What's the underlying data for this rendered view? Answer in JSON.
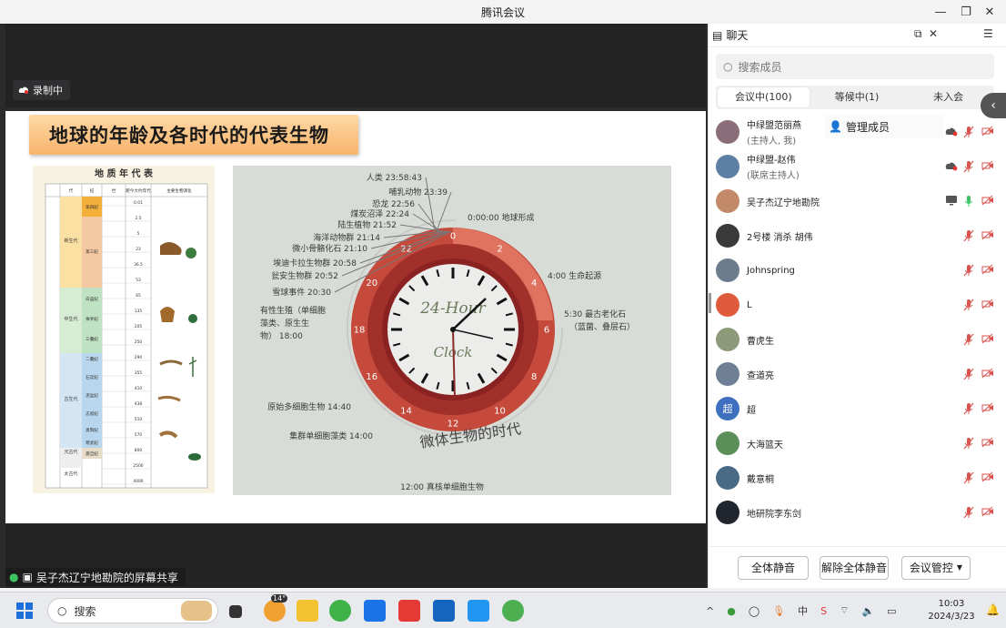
{
  "window": {
    "title": "腾讯会议"
  },
  "recording": {
    "label": "录制中"
  },
  "screen_share": {
    "label": "吴子杰辽宁地勘院的屏幕共享"
  },
  "slide": {
    "title": "地球的年龄及各时代的代表生物",
    "table_title": "地 质 年 代 表",
    "table_headers": [
      "代",
      "纪",
      "世",
      "距今大约年代(百万年)",
      "主要生物演化"
    ],
    "eras": [
      "新生代",
      "中生代",
      "古生代",
      "元古代",
      "太古代"
    ],
    "periods": [
      "第四纪",
      "第三纪",
      "白垩纪",
      "侏罗纪",
      "三叠纪",
      "二叠纪",
      "石炭纪",
      "泥盆纪",
      "志留纪",
      "奥陶纪",
      "寒武纪",
      "震旦纪"
    ],
    "ages_mya": [
      "0.01",
      "2.5",
      "5",
      "23",
      "36.5",
      "53",
      "65",
      "135",
      "205",
      "250",
      "290",
      "355",
      "410",
      "438",
      "510",
      "570",
      "800",
      "2500",
      "4000"
    ],
    "clock": {
      "face_label_1": "24-Hour",
      "face_label_2": "Clock",
      "arc_label": "微体生物的时代",
      "numbers": [
        "0",
        "2",
        "4",
        "6",
        "8",
        "10",
        "12",
        "14",
        "16",
        "18",
        "20",
        "22"
      ],
      "events": [
        {
          "text": "人类 23:58:43"
        },
        {
          "text": "哺乳动物 23:39"
        },
        {
          "text": "恐龙 22:56"
        },
        {
          "text": "煤炭沼泽 22:24"
        },
        {
          "text": "陆生植物 21:52"
        },
        {
          "text": "海洋动物群 21:14"
        },
        {
          "text": "微小骨骼化石 21:10"
        },
        {
          "text": "埃迪卡拉生物群 20:58"
        },
        {
          "text": "瓮安生物群 20:52"
        },
        {
          "text": "雪球事件 20:30"
        },
        {
          "text": "有性生殖（单细胞藻类、原生生物） 18:00"
        },
        {
          "text": "原始多细胞生物 14:40"
        },
        {
          "text": "集群单细胞藻类 14:00"
        },
        {
          "text": "12:00 真核单细胞生物"
        },
        {
          "text": "0:00:00 地球形成"
        },
        {
          "text": "4:00 生命起源"
        },
        {
          "text": "5:30 最古老化石（蓝菌、叠层石）"
        }
      ]
    }
  },
  "sidebar": {
    "tab_chat": "聊天",
    "tab_members": "管理成员",
    "search_placeholder": "搜索成员",
    "status_tabs": [
      "会议中(100)",
      "等候中(1)",
      "未入会"
    ],
    "members": [
      {
        "name": "中绿盟范丽燕",
        "sub": "(主持人, 我)",
        "avatar_color": "#8a6f7a"
      },
      {
        "name": "中绿盟-赵伟",
        "sub": "(联席主持人)",
        "avatar_color": "#5d7fa6"
      },
      {
        "name": "吴子杰辽宁地勘院",
        "sub": "",
        "avatar_color": "#c38a6a"
      },
      {
        "name": "2号楼 消杀 胡伟",
        "sub": "",
        "avatar_color": "#3a3a3a"
      },
      {
        "name": "Johnspring",
        "sub": "",
        "avatar_color": "#6b7c8c"
      },
      {
        "name": "L",
        "sub": "",
        "avatar_color": "#e05a3c"
      },
      {
        "name": "曹虎生",
        "sub": "",
        "avatar_color": "#8c9a7a"
      },
      {
        "name": "查道亮",
        "sub": "",
        "avatar_color": "#6e7f96"
      },
      {
        "name": "超",
        "sub": "",
        "avatar_color": "#3f6fbf",
        "initial": "超"
      },
      {
        "name": "大海篮天",
        "sub": "",
        "avatar_color": "#5a8f5a"
      },
      {
        "name": "戴意桐",
        "sub": "",
        "avatar_color": "#4a6a86"
      },
      {
        "name": "地研院李东剑",
        "sub": "",
        "avatar_color": "#20252e"
      }
    ],
    "buttons": {
      "mute_all": "全体静音",
      "unmute_all": "解除全体静音",
      "control": "会议管控"
    }
  },
  "taskbar": {
    "search_label": "搜索",
    "weather": "14°",
    "time": "10:03",
    "date": "2024/3/23"
  }
}
